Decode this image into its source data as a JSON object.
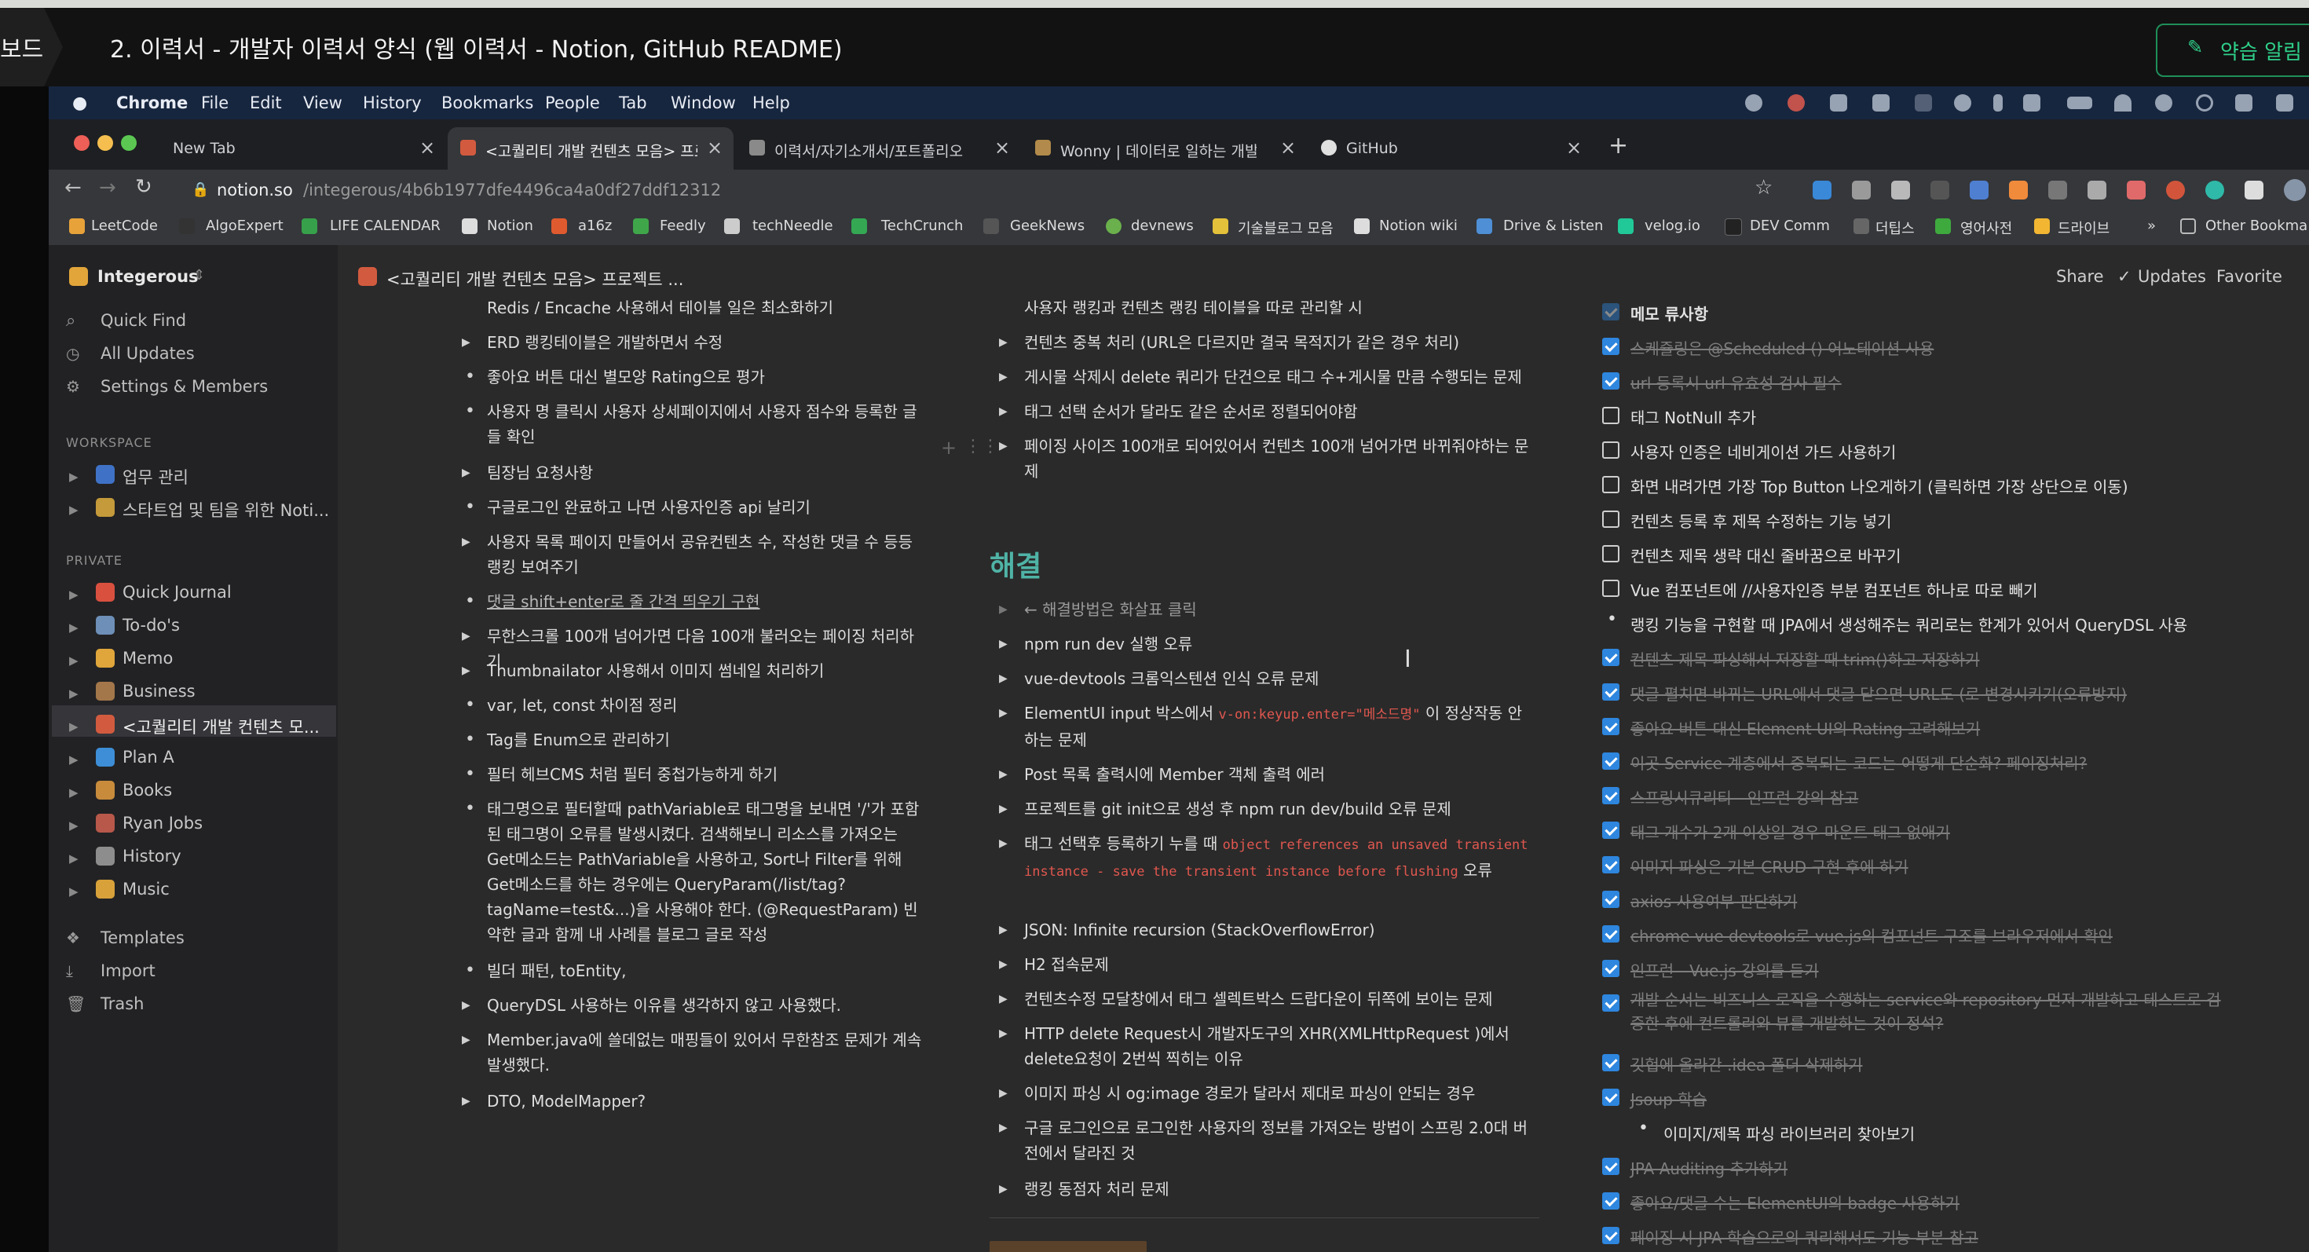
{
  "outer": {
    "back_label": "보드",
    "title": "2. 이력서 - 개발자 이력서 양식 (웹 이력서 - Notion, GitHub README)",
    "alarm_label": "약습 알림"
  },
  "menubar": {
    "items": [
      "Chrome",
      "File",
      "Edit",
      "View",
      "History",
      "Bookmarks",
      "People",
      "Tab",
      "Window",
      "Help"
    ]
  },
  "browser": {
    "tabs": [
      {
        "title": "New Tab"
      },
      {
        "title": "<고퀄리티 개발 컨텐츠 모음> 프로"
      },
      {
        "title": "이력서/자기소개서/포트폴리오"
      },
      {
        "title": "Wonny | 데이터로 일하는 개발자"
      },
      {
        "title": "GitHub"
      }
    ],
    "new_tab": "+",
    "url_domain": "notion.so",
    "url_path": "/integerous/4b6b1977dfe4496ca4a0df27ddf12312",
    "bookmarks": [
      "LeetCode",
      "AlgoExpert",
      "LIFE CALENDAR",
      "Notion",
      "a16z",
      "Feedly",
      "techNeedle",
      "TechCrunch",
      "GeekNews",
      "devnews",
      "기술블로그 모음",
      "Notion wiki",
      "Drive & Listen",
      "velog.io",
      "DEV Comm",
      "더팁스",
      "영어사전",
      "드라이브",
      "»",
      "Other Bookma"
    ]
  },
  "notion": {
    "workspace": "Integerous",
    "breadcrumb": "<고퀄리티 개발 컨텐츠 모음> 프로젝트 ...",
    "share": "Share",
    "updates": "Updates",
    "favorite": "Favorite",
    "sidebar": {
      "quick_find": "Quick Find",
      "all_updates": "All Updates",
      "settings": "Settings & Members",
      "workspace_heading": "WORKSPACE",
      "workspace_pages": [
        "업무 관리",
        "스타트업 및 팀을 위한 Noti..."
      ],
      "private_heading": "PRIVATE",
      "private_pages": [
        "Quick Journal",
        "To-do's",
        "Memo",
        "Business",
        "<고퀄리티 개발 컨텐츠 모...",
        "Plan A",
        "Books",
        "Ryan Jobs",
        "History",
        "Music"
      ],
      "templates": "Templates",
      "import": "Import",
      "trash": "Trash"
    },
    "col1": [
      "Redis / Encache 사용해서 테이블 일은 최소화하기",
      "ERD 랭킹테이블은 개발하면서 수정",
      "좋아요 버튼 대신 별모양 Rating으로 평가",
      "사용자 명 클릭시 사용자 상세페이지에서 사용자 점수와 등록한 글들 확인",
      "팀장님 요청사항",
      "구글로그인 완료하고 나면 사용자인증 api 날리기",
      "사용자 목록 페이지 만들어서 공유컨텐츠 수, 작성한 댓글 수 등등 랭킹 보여주기",
      "댓글 shift+enter로 줄 간격 띄우기 구현",
      "무한스크롤 100개 넘어가면 다음 100개 불러오는 페이징 처리하기",
      "Thumbnailator 사용해서 이미지 썸네일 처리하기",
      "var, let, const 차이점 정리",
      "Tag를 Enum으로 관리하기",
      "필터 헤브CMS 처럼 필터 중첩가능하게 하기",
      "태그명으로 필터할때 pathVariable로 태그명을 보내면 '/'가 포함된 태그명이 오류를 발생시켰다. 검색해보니 리소스를 가져오는 Get메소드는 PathVariable을 사용하고, Sort나 Filter를 위해 Get메소드를 하는 경우에는 QueryParam(/list/tag?tagName=test&...)을 사용해야 한다. (@RequestParam) 빈약한 글과 함께 내 사례를 블로그 글로 작성",
      "빌더 패턴, toEntity,",
      "QueryDSL 사용하는 이유를 생각하지 않고 사용했다.",
      "Member.java에 쓸데없는 매핑들이 있어서 무한참조 문제가 계속 발생했다.",
      "DTO, ModelMapper?"
    ],
    "col2_top": [
      "사용자 랭킹과 컨텐츠 랭킹 테이블을 따로 관리할 시",
      "컨텐츠 중복 처리 (URL은 다르지만 결국 목적지가 같은 경우 처리)",
      "게시물 삭제시 delete 쿼리가 단건으로 태그 수+게시물 만큼 수행되는 문제",
      "태그 선택 순서가 달라도 같은 순서로 정렬되어야함",
      "페이징 사이즈 100개로 되어있어서 컨텐츠 100개 넘어가면 바뀌줘야하는 문제"
    ],
    "col2_heading": "해결",
    "col2_hint": "← 해결방법은 화살표 클릭",
    "col2": [
      "npm run dev 실행 오류",
      "vue-devtools 크롬익스텐션 인식 오류 문제",
      "ElementUI input 박스에서 __CODE1__ 이 정상작동 안하는 문제",
      "Post 목록 출력시에 Member 객체 출력 에러",
      "프로젝트를 git init으로 생성 후 npm run dev/build 오류 문제",
      "태그 선택후 등록하기 누를 때 __CODE2__ 오류",
      "JSON: Infinite recursion (StackOverflowError)",
      "H2 접속문제",
      "컨텐츠수정 모달창에서 태그 셀렉트박스 드랍다운이 뒤쪽에 보이는 문제",
      "HTTP delete Request시 개발자도구의 XHR(XMLHttpRequest )에서 delete요청이 2번씩 찍히는 이유",
      "이미지 파싱 시 og:image 경로가 달라서 제대로 파싱이 안되는 경우",
      "구글 로그인으로 로그인한 사용자의 정보를 가져오는 방법이 스프링 2.0대 버전에서 달라진 것",
      "랭킹 동점자 처리 문제"
    ],
    "code1": "v-on:keyup.enter=\"메소드명\"",
    "code2": "object references an unsaved transient instance - save the transient instance before flushing",
    "col3_heading": "메모 류사항",
    "col3": [
      {
        "text": "스케쥴링은 @Scheduled () 어노테이션 사용",
        "done": true
      },
      {
        "text": "url 등록시 url 유효성 검사 필수",
        "done": true
      },
      {
        "text": "태그 NotNull 추가",
        "done": false
      },
      {
        "text": "사용자 인증은 네비게이션 가드 사용하기",
        "done": false
      },
      {
        "text": "화면 내려가면 가장 Top Button 나오게하기 (클릭하면 가장 상단으로 이동)",
        "done": false
      },
      {
        "text": "컨텐츠 등록 후 제목 수정하는 기능 넣기",
        "done": false
      },
      {
        "text": "컨텐츠 제목 생략 대신 줄바꿈으로 바꾸기",
        "done": false
      },
      {
        "text": "Vue 컴포넌트에 //사용자인증 부분 컴포넌트 하나로 따로 빼기",
        "done": false
      },
      {
        "text": "랭킹 기능을 구현할 때 JPA에서 생성해주는 쿼리로는 한계가 있어서 QueryDSL 사용",
        "bullet": true
      },
      {
        "text": "컨텐츠 제목 파싱해서 저장할 때 trim()하고 저장하기",
        "done": true
      },
      {
        "text": "댓글 펼치면 바뀌는 URL에서 댓글 닫으면 URL도 (로 변경시키기(오류방지)",
        "done": true
      },
      {
        "text": "좋아요 버튼 대신 Element UI의 Rating 고려해보기",
        "done": true
      },
      {
        "text": "이곳 Service 계층에서 중복되는 코드는 어떻게 단순화? 페이징처리?",
        "done": true
      },
      {
        "text": "스프링시큐리티 - 인프런 강의 참고",
        "done": true
      },
      {
        "text": "태그 개수가 2개 이상일 경우 마운트 태그 없애기",
        "done": true
      },
      {
        "text": "이미지 파싱은 기본 CRUD 구현 후에 하기",
        "done": true
      },
      {
        "text": "axios 사용여부 판단하기",
        "done": true
      },
      {
        "text": "chrome vue devtools로 vue.js의 컴포넌트 구조를 브라우저에서 확인",
        "done": true
      },
      {
        "text": "인프런 - Vue.js 강의를 듣기",
        "done": true
      },
      {
        "text": "개발 순서는 비즈니스 로직을 수행하는 service와 repository 먼저 개발하고 테스트로 검증한 후에 컨트롤러와 뷰를 개발하는 것이 정석?",
        "done": true
      },
      {
        "text": "깃헙에 올라간 .idea 폴더 삭제하기",
        "done": true
      },
      {
        "text": "Jsoup 학습",
        "done": true
      },
      {
        "text": "이미지/제목 파싱 라이브러리 찾아보기",
        "sub": true
      },
      {
        "text": "JPA Auditing 추가하기",
        "done": true
      },
      {
        "text": "좋아요/댓글 수는 ElementUI의 badge 사용하기",
        "done": true
      },
      {
        "text": "페이징 시 JPA 학습으로의 쿼리해서도 기능 부분 참고",
        "done": true
      }
    ]
  }
}
